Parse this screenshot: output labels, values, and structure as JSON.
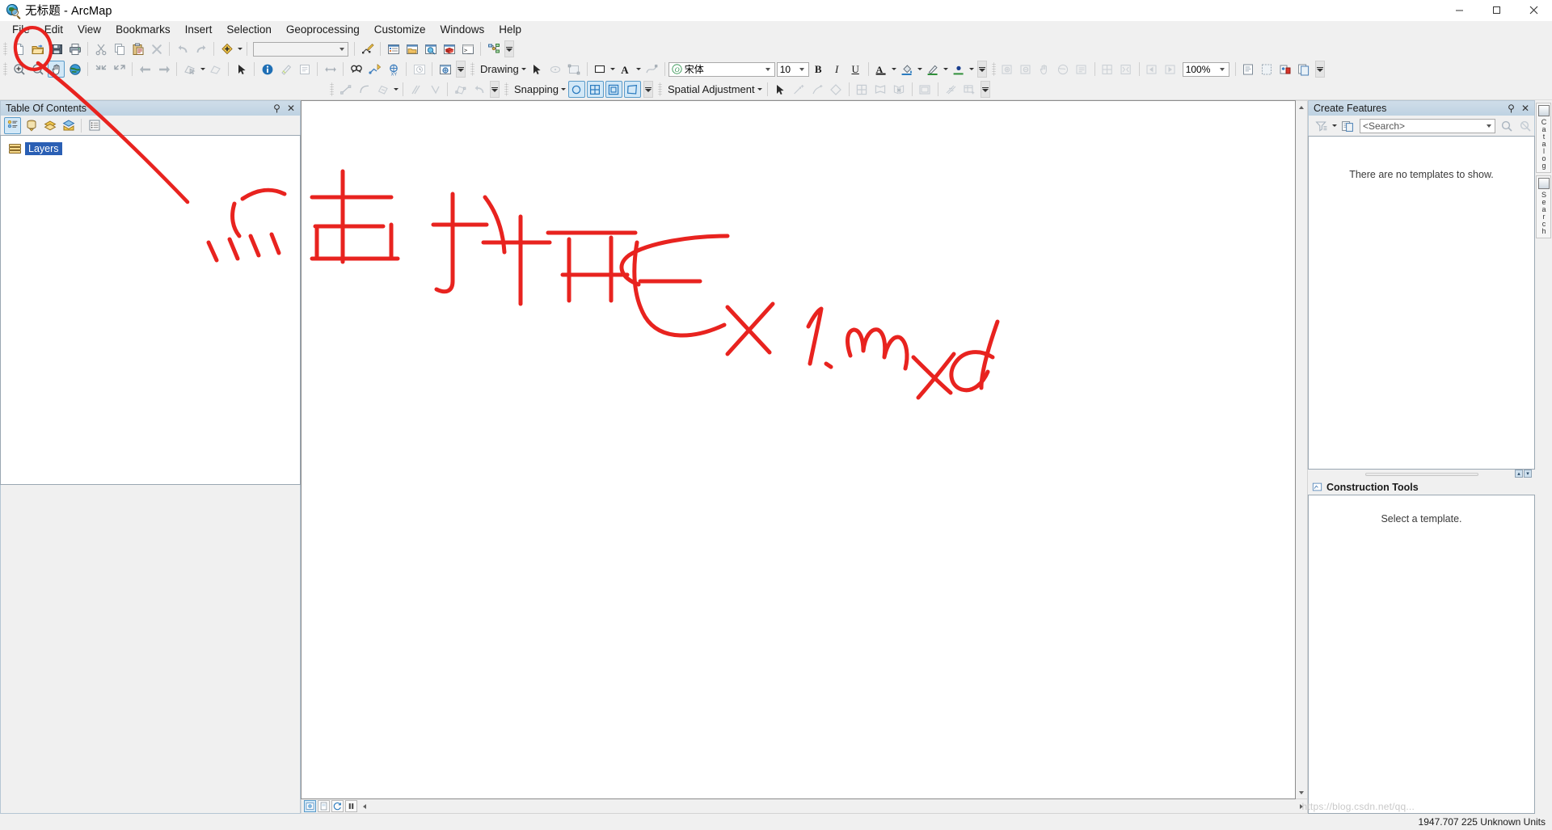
{
  "window": {
    "title_document": "无标题",
    "title_app": " - ArcMap",
    "app_icon": "arcmap-globe-icon",
    "minimize_label": "—",
    "maximize_label": "▭",
    "close_label": "✕"
  },
  "menubar": {
    "items": [
      {
        "label": "File",
        "name": "menu-file"
      },
      {
        "label": "Edit",
        "name": "menu-edit"
      },
      {
        "label": "View",
        "name": "menu-view"
      },
      {
        "label": "Bookmarks",
        "name": "menu-bookmarks"
      },
      {
        "label": "Insert",
        "name": "menu-insert"
      },
      {
        "label": "Selection",
        "name": "menu-selection"
      },
      {
        "label": "Geoprocessing",
        "name": "menu-geoprocessing"
      },
      {
        "label": "Customize",
        "name": "menu-customize"
      },
      {
        "label": "Windows",
        "name": "menu-windows"
      },
      {
        "label": "Help",
        "name": "menu-help"
      }
    ]
  },
  "standard_toolbar": {
    "combo_value": "",
    "zoom_value": "100%"
  },
  "drawing_toolbar": {
    "label": "Drawing",
    "font_name": "宋体",
    "font_size": "10",
    "bold": "B",
    "italic": "I",
    "underline": "U",
    "font_color_glyph": "A"
  },
  "snapping_toolbar": {
    "label": "Snapping"
  },
  "spatial_adjustment_toolbar": {
    "label": "Spatial Adjustment"
  },
  "table_of_contents": {
    "title": "Table Of Contents",
    "pin_glyph": "⚲",
    "close_glyph": "✕",
    "root_item": "Layers"
  },
  "create_features": {
    "title": "Create Features",
    "pin_glyph": "⚲",
    "close_glyph": "✕",
    "search_placeholder": "<Search>",
    "empty_message": "There are no templates to show."
  },
  "construction_tools": {
    "title": "Construction Tools",
    "empty_message": "Select a template."
  },
  "right_tabs": [
    {
      "label": "Catalog",
      "name": "tab-catalog"
    },
    {
      "label": "Search",
      "name": "tab-search"
    }
  ],
  "status_bar": {
    "coordinates": "1947.707 225 Unknown Units"
  },
  "annotation": {
    "handwriting_text": "点击打开 Ex1.mxd",
    "color": "#e8231f",
    "target": "open-document-button"
  },
  "watermark": {
    "text": "https://blog.csdn.net/qq..."
  }
}
